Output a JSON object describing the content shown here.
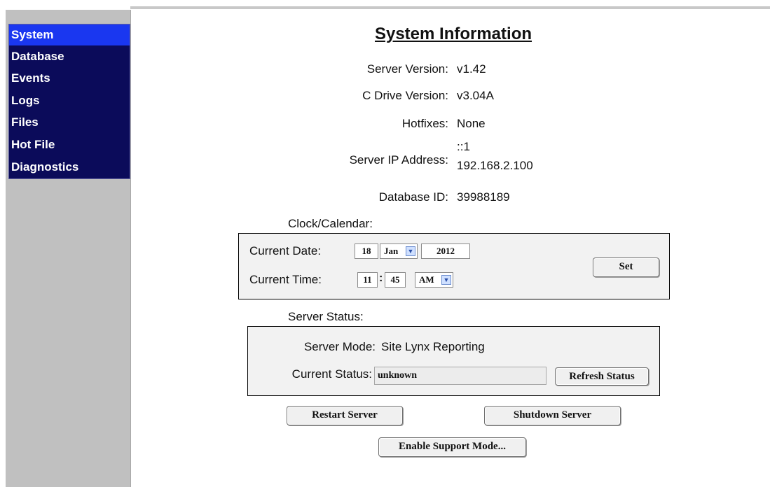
{
  "nav": {
    "items": [
      {
        "label": "System"
      },
      {
        "label": "Database"
      },
      {
        "label": "Events"
      },
      {
        "label": "Logs"
      },
      {
        "label": "Files"
      },
      {
        "label": "Hot File"
      },
      {
        "label": "Diagnostics"
      }
    ],
    "active": "System"
  },
  "page": {
    "title": "System Information"
  },
  "info": {
    "server_version_label": "Server Version:",
    "server_version": "v1.42",
    "c_drive_label": "C Drive Version:",
    "c_drive": "v3.04A",
    "hotfixes_label": "Hotfixes:",
    "hotfixes": "None",
    "ip_label": "Server IP Address:",
    "ip_1": "::1",
    "ip_2": "192.168.2.100",
    "db_id_label": "Database ID:",
    "db_id": "39988189"
  },
  "clock": {
    "section_label": "Clock/Calendar:",
    "date_label": "Current Date:",
    "day": "18",
    "month": "Jan",
    "year": "2012",
    "time_label": "Current Time:",
    "hour": "11",
    "colon": ":",
    "minute": "45",
    "ampm": "AM",
    "set_label": "Set"
  },
  "status": {
    "section_label": "Server Status:",
    "mode_label": "Server Mode:",
    "mode": "Site Lynx Reporting",
    "current_label": "Current Status:",
    "current": "unknown",
    "refresh_label": "Refresh Status"
  },
  "actions": {
    "restart_label": "Restart Server",
    "shutdown_label": "Shutdown Server",
    "support_label": "Enable Support Mode..."
  },
  "colors": {
    "nav_bg": "#0b0b5a",
    "nav_active": "#1a37f0",
    "sidebar_bg": "#c0c0c0"
  }
}
